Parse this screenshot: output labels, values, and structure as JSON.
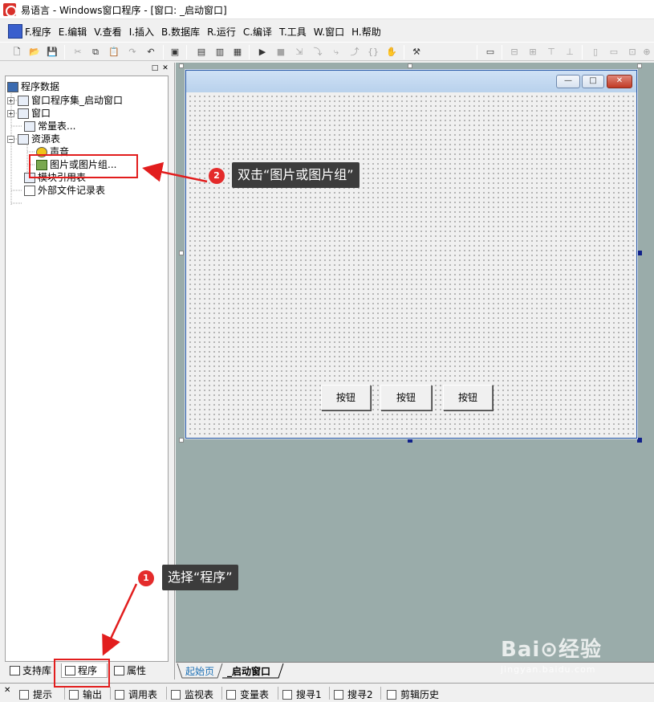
{
  "window": {
    "title": "易语言 - Windows窗口程序 - [窗口: _启动窗口]"
  },
  "menu": {
    "items": [
      "F.程序",
      "E.编辑",
      "V.查看",
      "I.插入",
      "B.数据库",
      "R.运行",
      "C.编译",
      "T.工具",
      "W.窗口",
      "H.帮助"
    ]
  },
  "toolbar": {
    "buttons": [
      {
        "name": "new-file-button",
        "glyph": "🗋"
      },
      {
        "name": "open-button",
        "glyph": "📂"
      },
      {
        "name": "save-button",
        "glyph": "💾"
      },
      {
        "name": "cut-button",
        "glyph": "✂"
      },
      {
        "name": "copy-button",
        "glyph": "⧉"
      },
      {
        "name": "paste-button",
        "glyph": "📋"
      },
      {
        "name": "redo-button",
        "glyph": "↷"
      },
      {
        "name": "undo-button",
        "glyph": "↶"
      },
      {
        "name": "find-button",
        "glyph": "▣"
      },
      {
        "name": "layout1-button",
        "glyph": "▤"
      },
      {
        "name": "layout2-button",
        "glyph": "▥"
      },
      {
        "name": "layout3-button",
        "glyph": "▦"
      },
      {
        "name": "run-button",
        "glyph": "▶"
      },
      {
        "name": "stop-button",
        "glyph": "■"
      },
      {
        "name": "step-button",
        "glyph": "⇲"
      },
      {
        "name": "step-into-button",
        "glyph": "⤵"
      },
      {
        "name": "step-over-button",
        "glyph": "⤷"
      },
      {
        "name": "step-out-button",
        "glyph": "⤴"
      },
      {
        "name": "run-to-cursor-button",
        "glyph": "{}"
      },
      {
        "name": "hand-button",
        "glyph": "✋"
      },
      {
        "name": "tool-button",
        "glyph": "⚒"
      },
      {
        "name": "form-button",
        "glyph": "▭"
      },
      {
        "name": "align-left-button",
        "glyph": "⊟"
      },
      {
        "name": "align-center-button",
        "glyph": "⊞"
      },
      {
        "name": "align-top-button",
        "glyph": "⊤"
      },
      {
        "name": "align-bottom-button",
        "glyph": "⊥"
      },
      {
        "name": "same-width-button",
        "glyph": "▯"
      },
      {
        "name": "same-height-button",
        "glyph": "▭"
      },
      {
        "name": "same-size-button",
        "glyph": "⊡"
      },
      {
        "name": "center-button",
        "glyph": "⊕"
      }
    ]
  },
  "tree": {
    "root": "程序数据",
    "items": [
      "窗口程序集_启动窗口",
      "窗口",
      "常量表...",
      "资源表",
      "声音",
      "图片或图片组...",
      "模块引用表",
      "外部文件记录表"
    ],
    "expanders": [
      "+",
      "+",
      "−"
    ]
  },
  "left_tabs": {
    "support": "支持库",
    "program": "程序",
    "property": "属性"
  },
  "form": {
    "buttons": [
      "按钮",
      "按钮",
      "按钮"
    ],
    "win_min": "—",
    "win_max": "□",
    "win_close": "✕"
  },
  "doc_tabs": {
    "start": "起始页",
    "main": "_启动窗口"
  },
  "bottom_tabs": [
    "提示",
    "输出",
    "调用表",
    "监视表",
    "变量表",
    "搜寻1",
    "搜寻2",
    "剪辑历史"
  ],
  "annotations": {
    "step1": {
      "number": "1",
      "text": "选择“程序”"
    },
    "step2": {
      "number": "2",
      "text": "双击“图片或图片组”"
    }
  },
  "watermark": {
    "main": "Bai⊙经验",
    "sub": "jingyan.baidu.com"
  },
  "colors": {
    "designer_bg": "#9aacaa",
    "annotation_red": "#e21d1d",
    "callout_bg": "#3c3c3c"
  }
}
